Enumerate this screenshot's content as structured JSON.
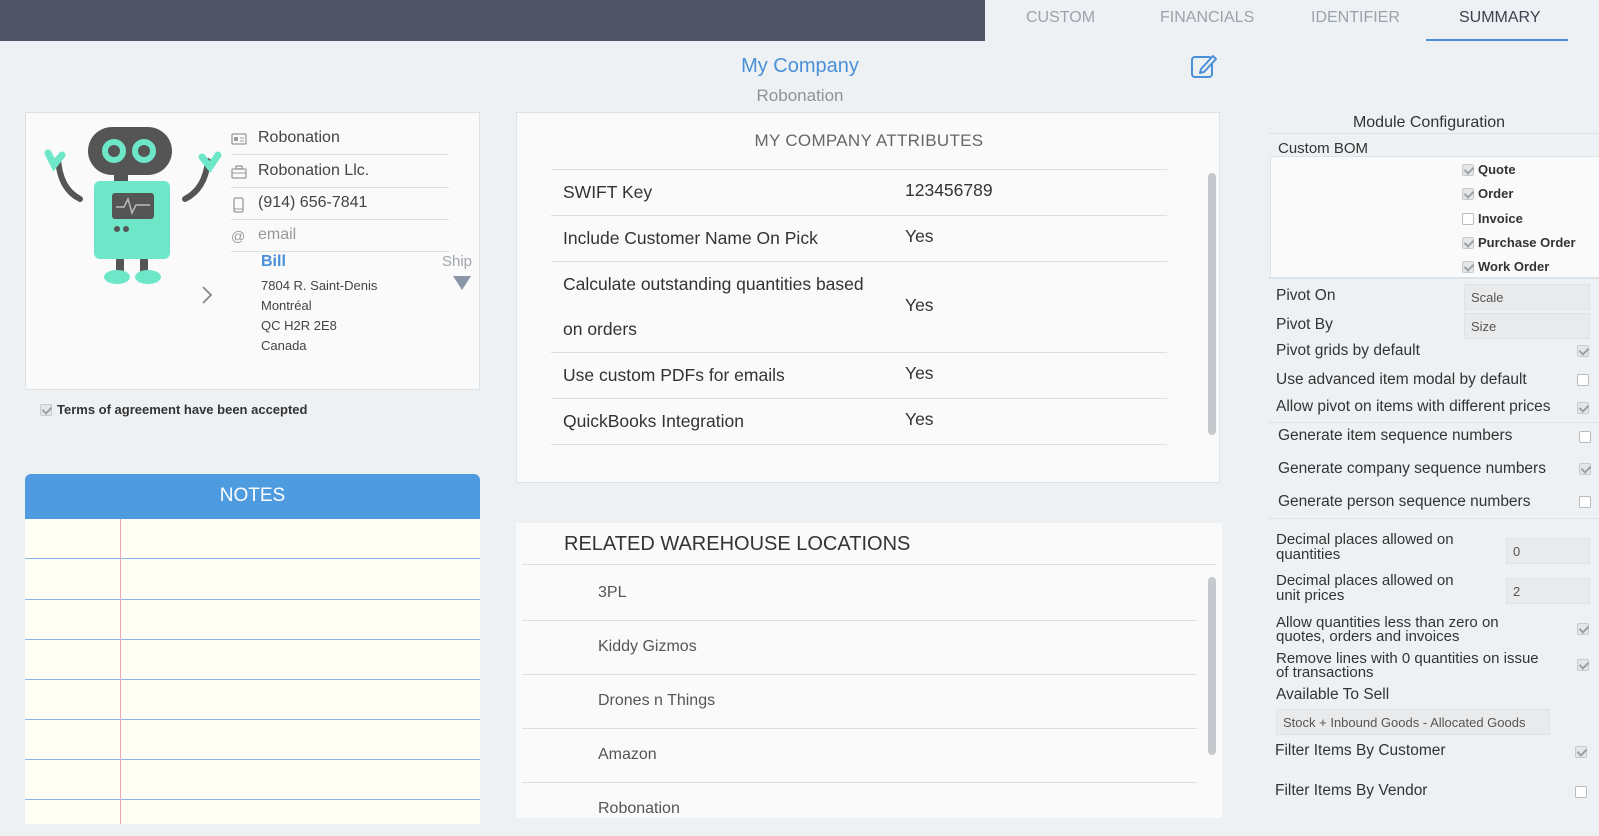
{
  "tabs": [
    {
      "label": "CUSTOM"
    },
    {
      "label": "FINANCIALS"
    },
    {
      "label": "IDENTIFIER"
    },
    {
      "label": "SUMMARY",
      "active": true
    }
  ],
  "header": {
    "title": "My Company",
    "subtitle": "Robonation"
  },
  "contact": {
    "name": "Robonation",
    "company": "Robonation Llc.",
    "phone": "(914) 656-7841",
    "email_placeholder": "email",
    "bill_label": "Bill",
    "ship_label": "Ship",
    "address": [
      "7804 R. Saint-Denis",
      "Montréal",
      "QC H2R 2E8",
      "Canada"
    ]
  },
  "terms": {
    "label": "Terms of agreement have been accepted",
    "checked": true
  },
  "notes": {
    "title": "NOTES"
  },
  "attributes": {
    "title": "MY COMPANY ATTRIBUTES",
    "rows": [
      {
        "key": "SWIFT Key",
        "value": "123456789"
      },
      {
        "key": "Include Customer Name On Pick",
        "value": "Yes"
      },
      {
        "key": "Calculate outstanding quantities based",
        "key2": "on orders",
        "value": "Yes"
      },
      {
        "key": "Use custom PDFs for emails",
        "value": "Yes"
      },
      {
        "key": "QuickBooks Integration",
        "value": "Yes"
      }
    ]
  },
  "warehouses": {
    "title": "RELATED WAREHOUSE LOCATIONS",
    "items": [
      "3PL",
      "Kiddy Gizmos",
      "Drones n Things",
      "Amazon",
      "Robonation"
    ]
  },
  "module": {
    "title": "Module Configuration",
    "custom_bom_label": "Custom BOM",
    "bom_options": [
      {
        "label": "Quote",
        "checked": true
      },
      {
        "label": "Order",
        "checked": true
      },
      {
        "label": "Invoice",
        "checked": false
      },
      {
        "label": "Purchase Order",
        "checked": true
      },
      {
        "label": "Work Order",
        "checked": true
      }
    ],
    "pivot_on_label": "Pivot On",
    "pivot_on_value": "Scale",
    "pivot_by_label": "Pivot By",
    "pivot_by_value": "Size",
    "pivot_grids_label": "Pivot grids by default",
    "advanced_modal_label": "Use advanced item modal by default",
    "allow_pivot_label": "Allow pivot on items with different prices",
    "gen_item_seq_label": "Generate item sequence numbers",
    "gen_company_seq_label": "Generate company sequence numbers",
    "gen_person_seq_label": "Generate person sequence numbers",
    "dec_qty_label_1": "Decimal places allowed on",
    "dec_qty_label_2": "quantities",
    "dec_qty_value": "0",
    "dec_price_label_1": "Decimal places allowed on",
    "dec_price_label_2": "unit prices",
    "dec_price_value": "2",
    "allow_neg_label_1": "Allow quantities less than zero on",
    "allow_neg_label_2": "quotes, orders and invoices",
    "remove_zero_label_1": "Remove lines with 0 quantities on issue",
    "remove_zero_label_2": "of transactions",
    "available_to_sell_label": "Available To Sell",
    "available_to_sell_value": "Stock + Inbound Goods - Allocated Goods",
    "filter_customer_label": "Filter Items By Customer",
    "filter_vendor_label": "Filter Items By Vendor"
  },
  "colors": {
    "accent": "#4a90d9",
    "topbar": "#4f5567",
    "robot": "#6ee6c8"
  }
}
